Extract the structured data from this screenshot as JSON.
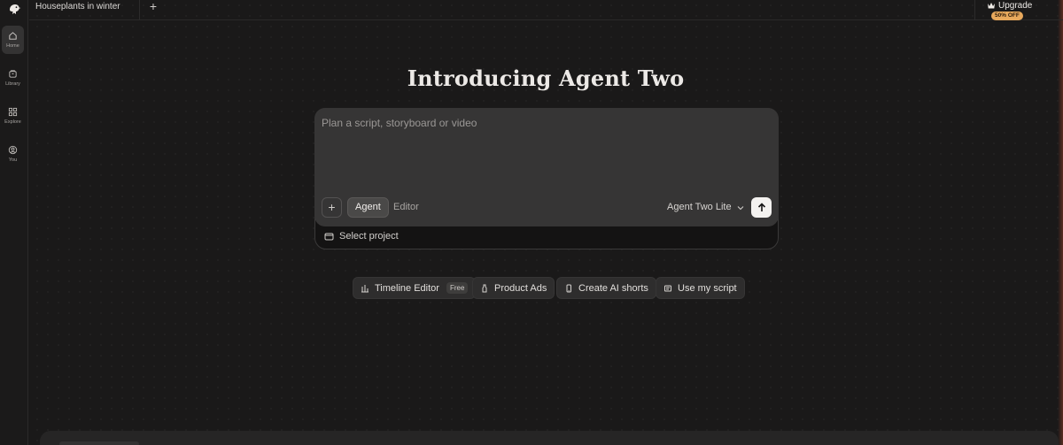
{
  "sidebar": {
    "logo_icon": "bird-logo-icon",
    "items": [
      {
        "label": "Home",
        "icon": "home-icon",
        "active": true
      },
      {
        "label": "Library",
        "icon": "library-icon",
        "active": false
      },
      {
        "label": "Explore",
        "icon": "grid-icon",
        "active": false
      },
      {
        "label": "You",
        "icon": "user-circle-icon",
        "active": false
      }
    ]
  },
  "topbar": {
    "tab_title": "Houseplants in winter",
    "new_tab_label": "+",
    "upgrade_label": "Upgrade",
    "upgrade_badge": "50% OFF",
    "badge_color": "#e7a85c"
  },
  "main": {
    "headline": "Introducing Agent Two",
    "composer": {
      "placeholder": "Plan a script, storyboard or video",
      "attach_label": "+",
      "modes": [
        "Agent",
        "Editor"
      ],
      "selected_mode": "Agent",
      "model_selected": "Agent Two Lite",
      "select_project_label": "Select project"
    },
    "quick_actions": [
      {
        "label": "Timeline Editor",
        "tag": "Free",
        "icon": "timeline-icon"
      },
      {
        "label": "Product Ads",
        "icon": "bottle-icon"
      },
      {
        "label": "Create AI shorts",
        "icon": "phone-icon"
      },
      {
        "label": "Use my script",
        "icon": "script-icon"
      }
    ]
  }
}
